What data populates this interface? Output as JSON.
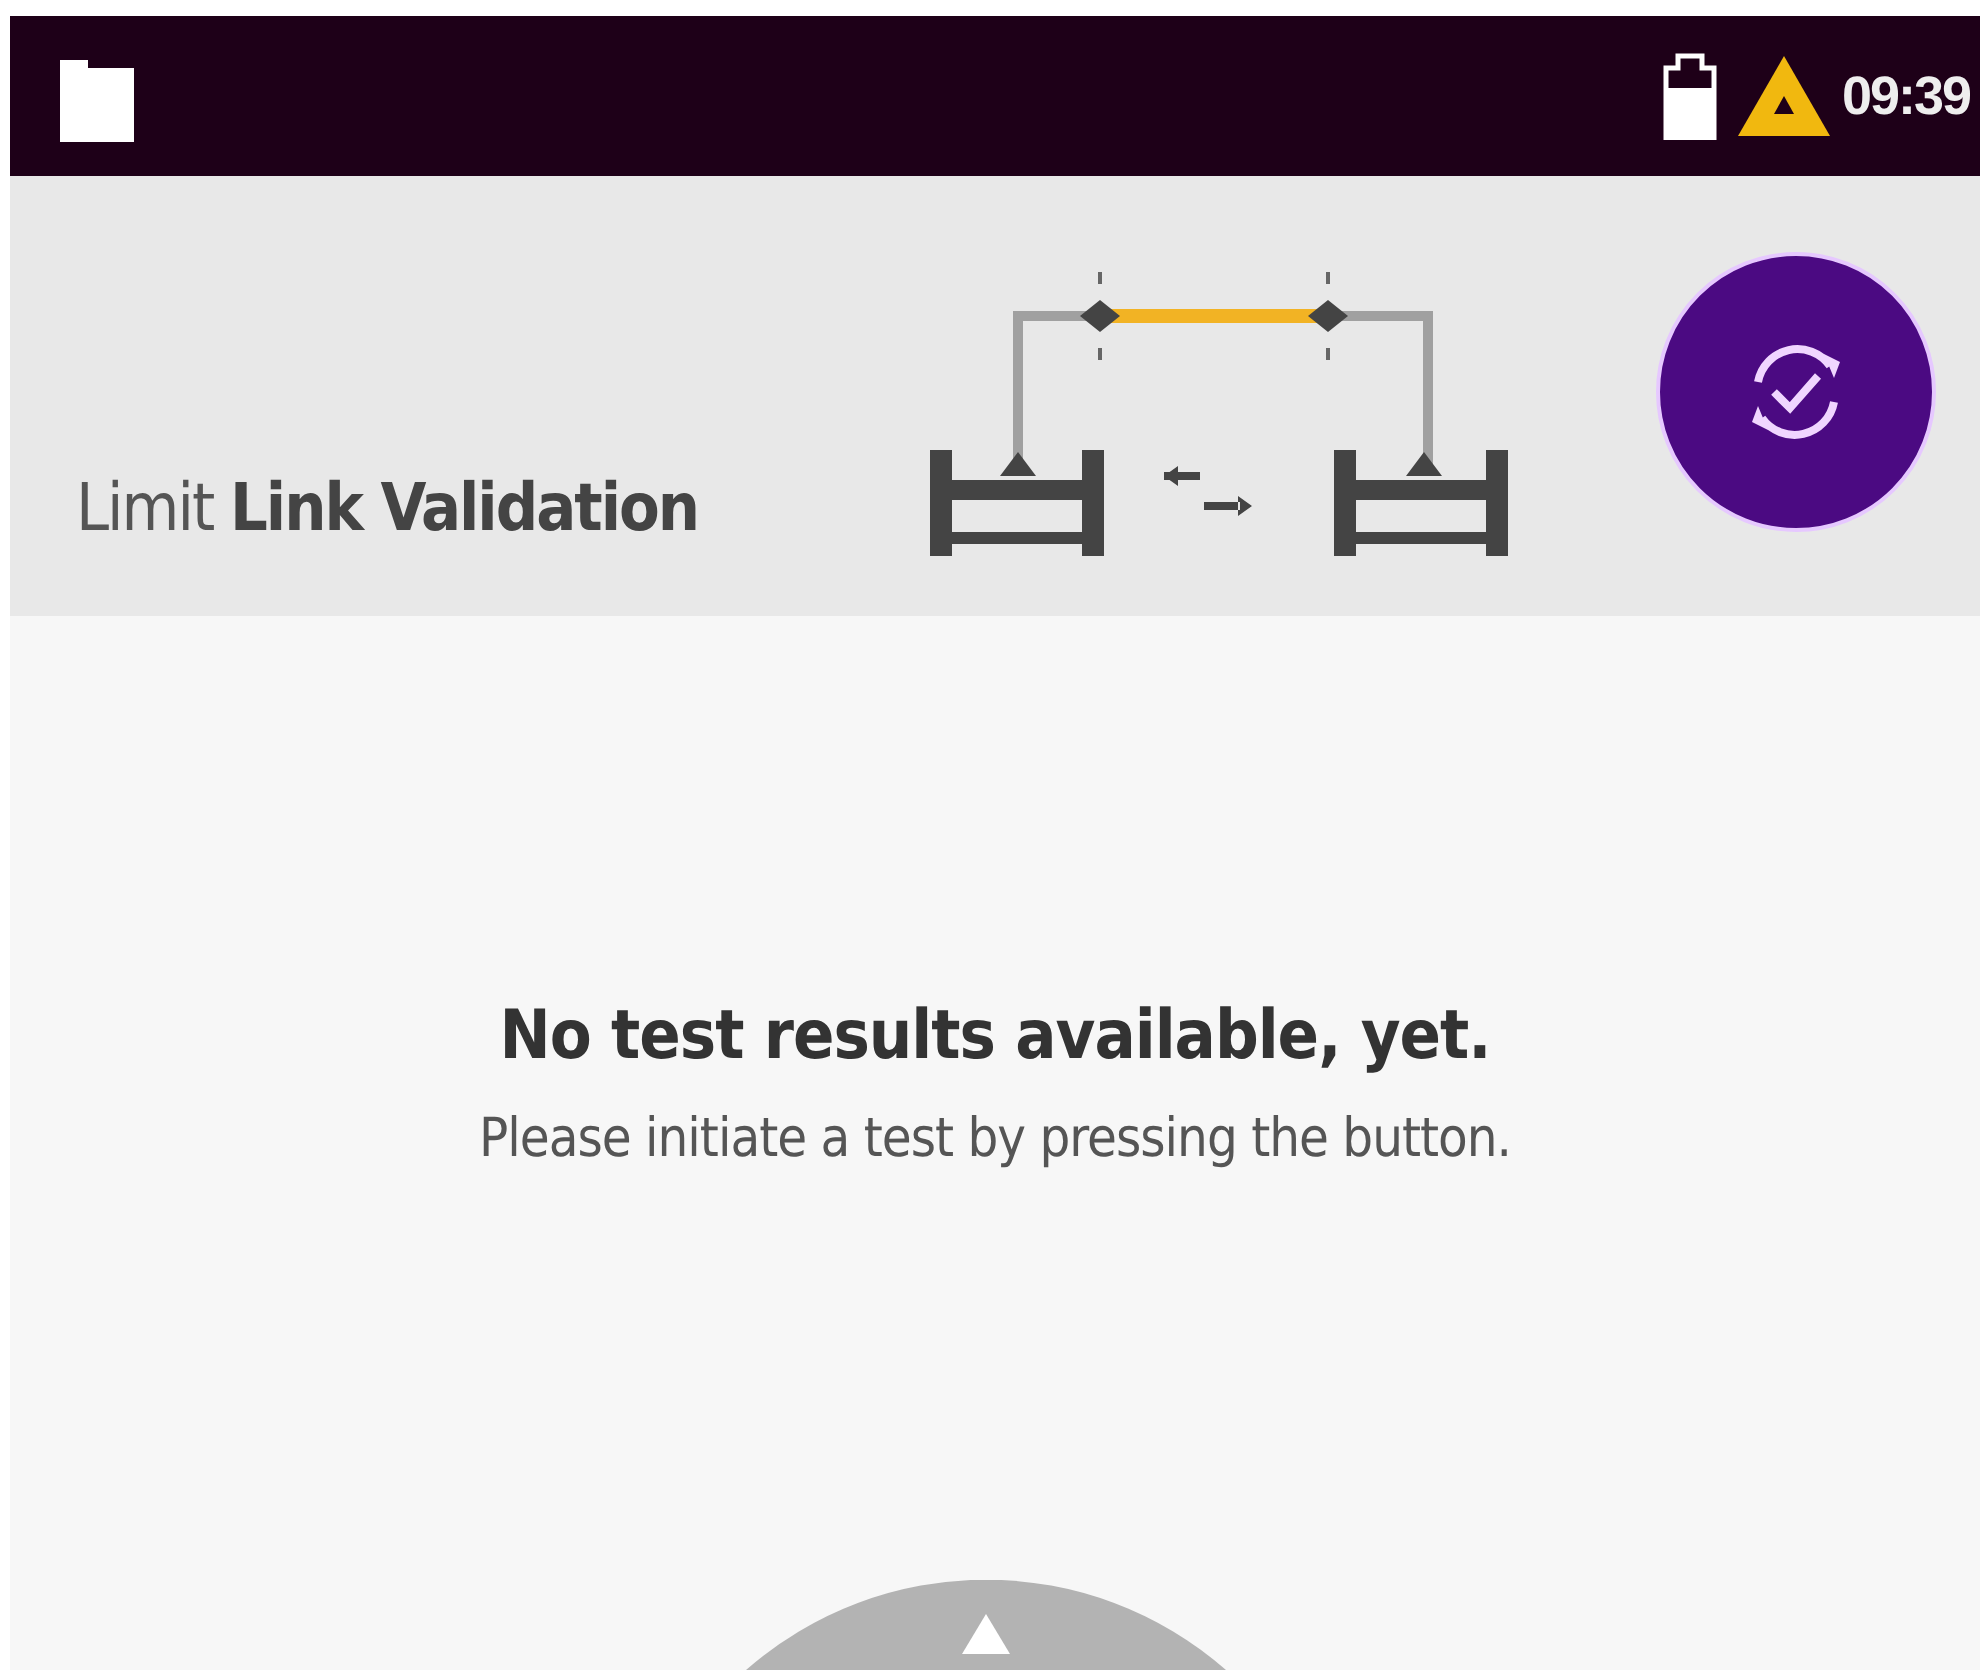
{
  "status_bar": {
    "time": "09:39"
  },
  "header": {
    "title": "Limit **Link Validation**"
  },
  "message": {
    "heading": "No test results available, yet.",
    "hint": "Please initiate a test by pressing the button."
  }
}
